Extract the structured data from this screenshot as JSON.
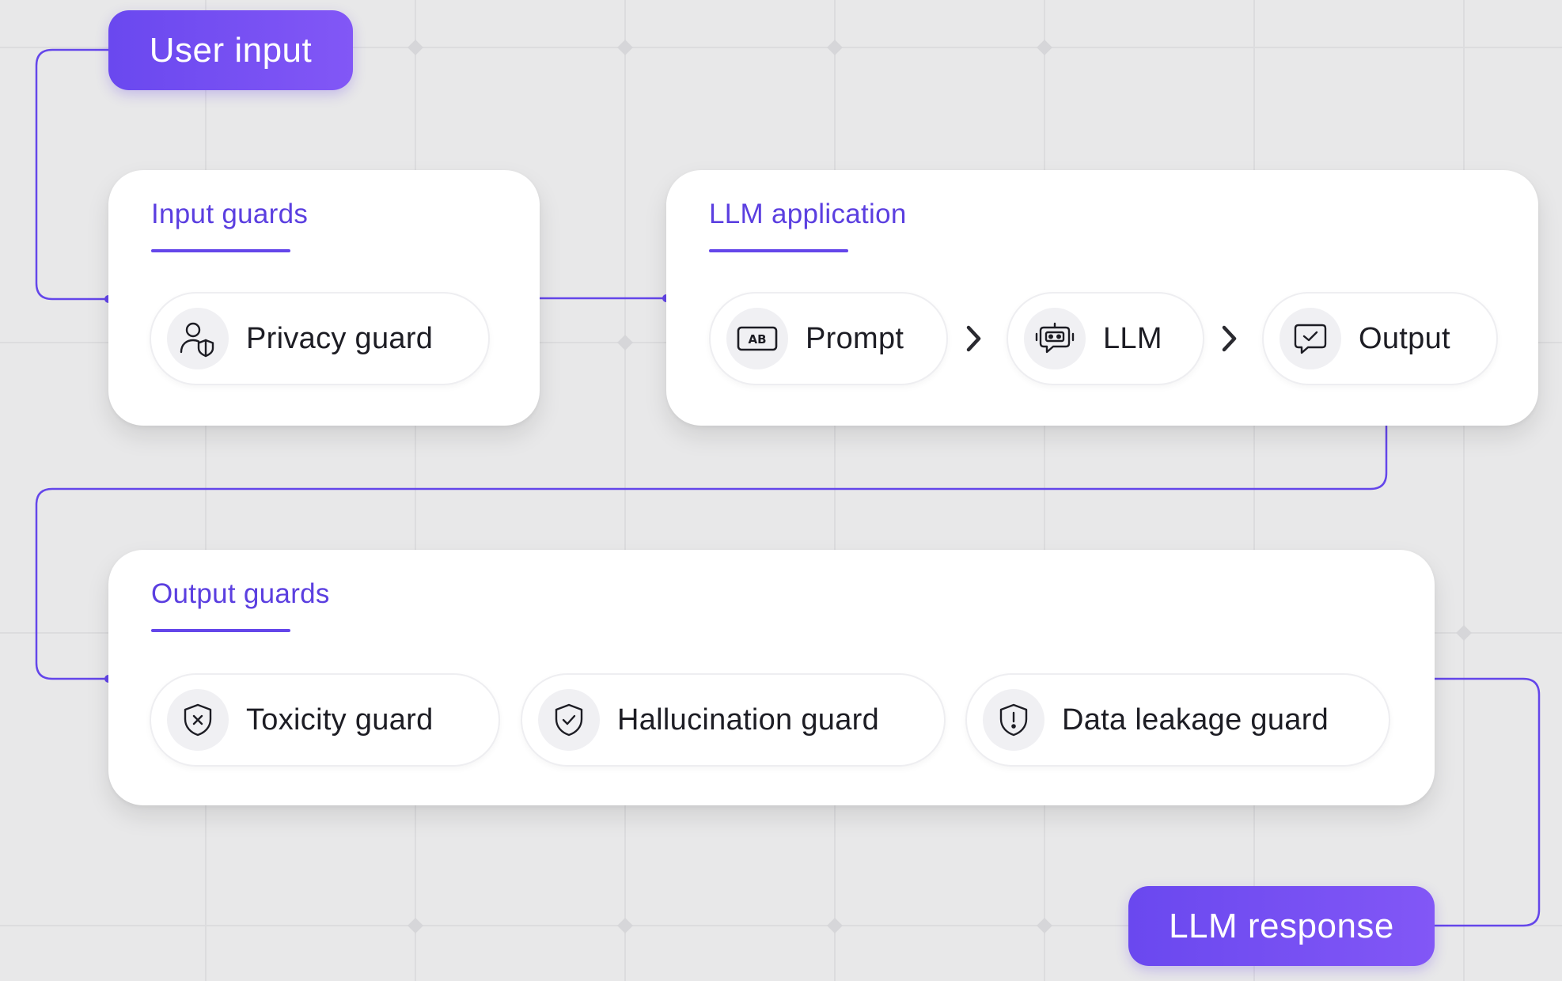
{
  "user_input": {
    "label": "User input"
  },
  "llm_response": {
    "label": "LLM response"
  },
  "input_guards": {
    "title": "Input guards",
    "items": [
      {
        "label": "Privacy guard",
        "icon": "user-shield-icon"
      }
    ]
  },
  "llm_application": {
    "title": "LLM application",
    "items": [
      {
        "label": "Prompt",
        "icon": "ab-text-icon"
      },
      {
        "label": "LLM",
        "icon": "robot-chip-icon"
      },
      {
        "label": "Output",
        "icon": "chat-check-icon"
      }
    ]
  },
  "output_guards": {
    "title": "Output guards",
    "items": [
      {
        "label": "Toxicity guard",
        "icon": "shield-x-icon"
      },
      {
        "label": "Hallucination guard",
        "icon": "shield-check-icon"
      },
      {
        "label": "Data leakage guard",
        "icon": "shield-exclamation-icon"
      }
    ]
  },
  "colors": {
    "accent": "#6446ea",
    "title": "#5b3fe0",
    "background": "#e8e8e9",
    "card": "#ffffff"
  }
}
